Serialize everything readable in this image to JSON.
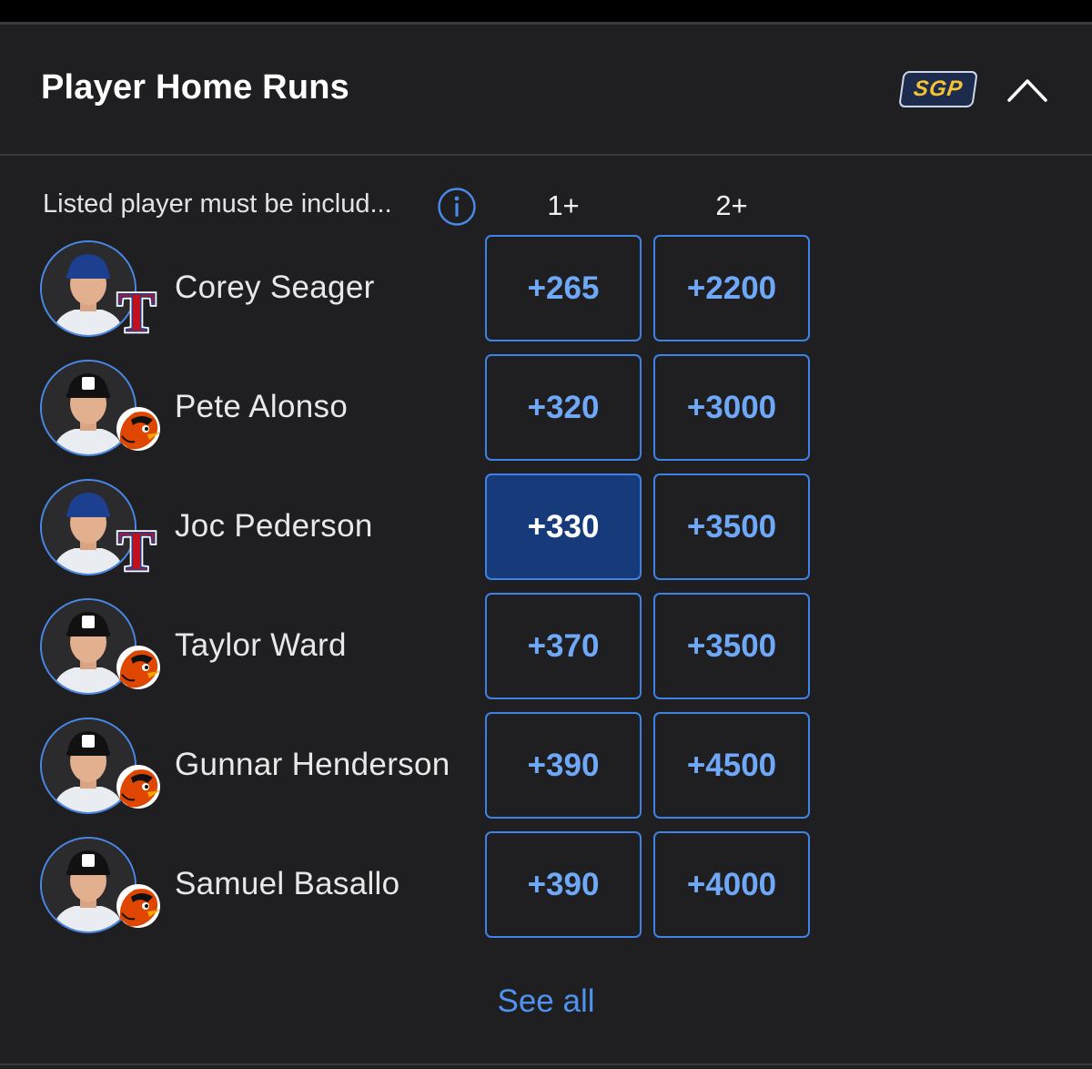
{
  "header": {
    "title": "Player Home Runs",
    "badge": "SGP"
  },
  "table": {
    "note": "Listed player must be includ...",
    "columns": [
      "1+",
      "2+"
    ],
    "rows": [
      {
        "player": "Corey Seager",
        "team_logo": "texas-rangers-logo",
        "odds": [
          "+265",
          "+2200"
        ],
        "selected": [
          false,
          false
        ]
      },
      {
        "player": "Pete Alonso",
        "team_logo": "baltimore-orioles-logo",
        "odds": [
          "+320",
          "+3000"
        ],
        "selected": [
          false,
          false
        ]
      },
      {
        "player": "Joc Pederson",
        "team_logo": "texas-rangers-logo",
        "odds": [
          "+330",
          "+3500"
        ],
        "selected": [
          true,
          false
        ]
      },
      {
        "player": "Taylor Ward",
        "team_logo": "baltimore-orioles-logo",
        "odds": [
          "+370",
          "+3500"
        ],
        "selected": [
          false,
          false
        ]
      },
      {
        "player": "Gunnar Henderson",
        "team_logo": "baltimore-orioles-logo",
        "odds": [
          "+390",
          "+4500"
        ],
        "selected": [
          false,
          false
        ]
      },
      {
        "player": "Samuel Basallo",
        "team_logo": "baltimore-orioles-logo",
        "odds": [
          "+390",
          "+4000"
        ],
        "selected": [
          false,
          false
        ]
      }
    ]
  },
  "footer": {
    "see_all": "See all"
  },
  "colors": {
    "background": "#1f1f21",
    "accent": "#3e82e6",
    "odds_text": "#6ea8f7",
    "selected_fill": "#163a7a",
    "sgp_text": "#f4c430",
    "rangers_red": "#c0111f",
    "orioles_orange": "#df4601"
  }
}
